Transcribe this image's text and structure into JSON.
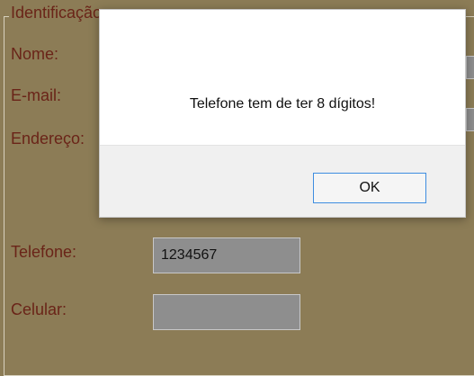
{
  "form": {
    "legend": "Identificação",
    "labels": {
      "nome": "Nome:",
      "email": "E-mail:",
      "endereco": "Endereço:",
      "telefone": "Telefone:",
      "celular": "Celular:"
    },
    "values": {
      "telefone": "1234567",
      "celular": ""
    }
  },
  "dialog": {
    "message": "Telefone tem de ter 8 dígitos!",
    "ok_label": "OK"
  }
}
